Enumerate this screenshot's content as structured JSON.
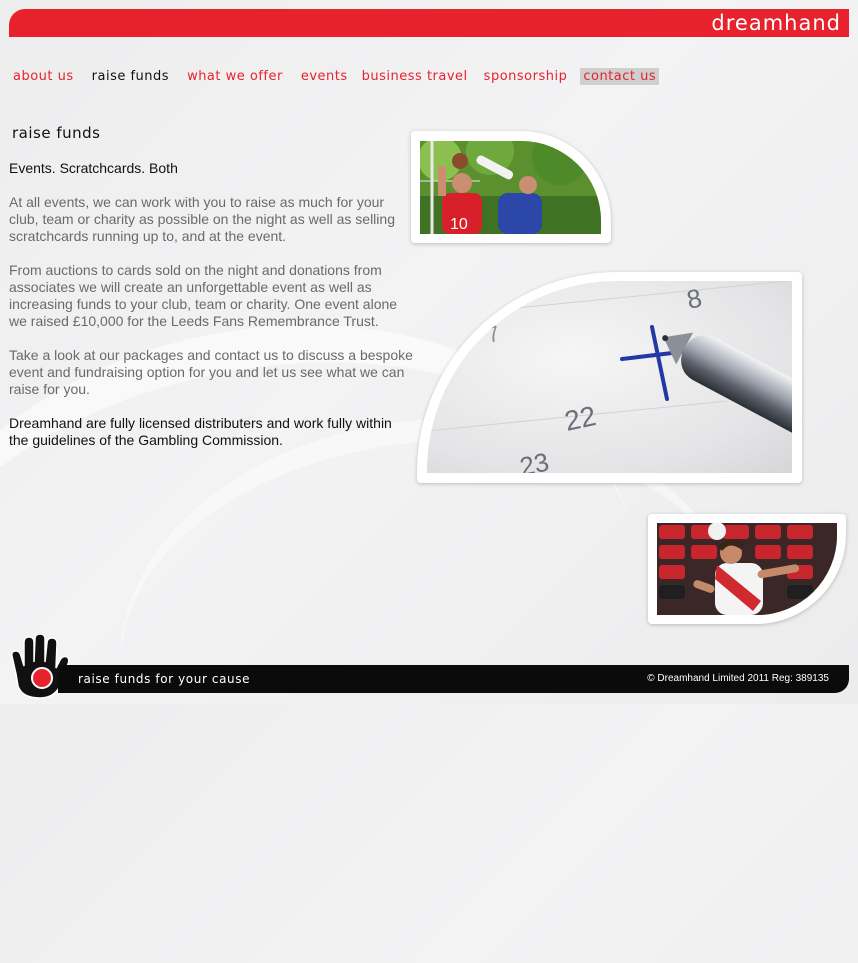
{
  "header": {
    "brand": "dreamhand"
  },
  "nav": {
    "items": [
      {
        "label": "about us"
      },
      {
        "label": "raise funds"
      },
      {
        "label": "what we offer"
      },
      {
        "label": "events"
      },
      {
        "label": "business travel"
      },
      {
        "label": "sponsorship"
      },
      {
        "label": "contact us"
      }
    ]
  },
  "main": {
    "title": "raise funds",
    "lead": "Events. Scratchcards. Both",
    "paragraphs": [
      "At all events, we can work with you to raise as much for your club, team or charity as possible on the night as well as selling scratchcards running up to, and at the event.",
      "From auctions to cards sold on the night and donations from associates we will create an unforgettable event as well as increasing funds to your club, team or charity. One event alone we raised £10,000 for the Leeds Fans Remembrance Trust.",
      "Take a look at our packages and contact us to discuss a bespoke event and fundraising option for you and let us see what we can raise for you."
    ],
    "closing": "Dreamhand are fully licensed distributers and work fully within the guidelines of the Gambling Commission."
  },
  "calendar": {
    "numbers": [
      "8",
      "7",
      "22",
      "23"
    ]
  },
  "players": {
    "shirt_number": "10"
  },
  "footer": {
    "tagline": "raise funds for your cause",
    "copyright": "© Dreamhand Limited 2011 Reg: 389135"
  },
  "colors": {
    "brand_red": "#e8222d",
    "footer_black": "#0b0b0b",
    "nav_current": "#111111",
    "nav_highlight_bg": "#cfcfcf",
    "body_text": "#6a6a6a"
  }
}
